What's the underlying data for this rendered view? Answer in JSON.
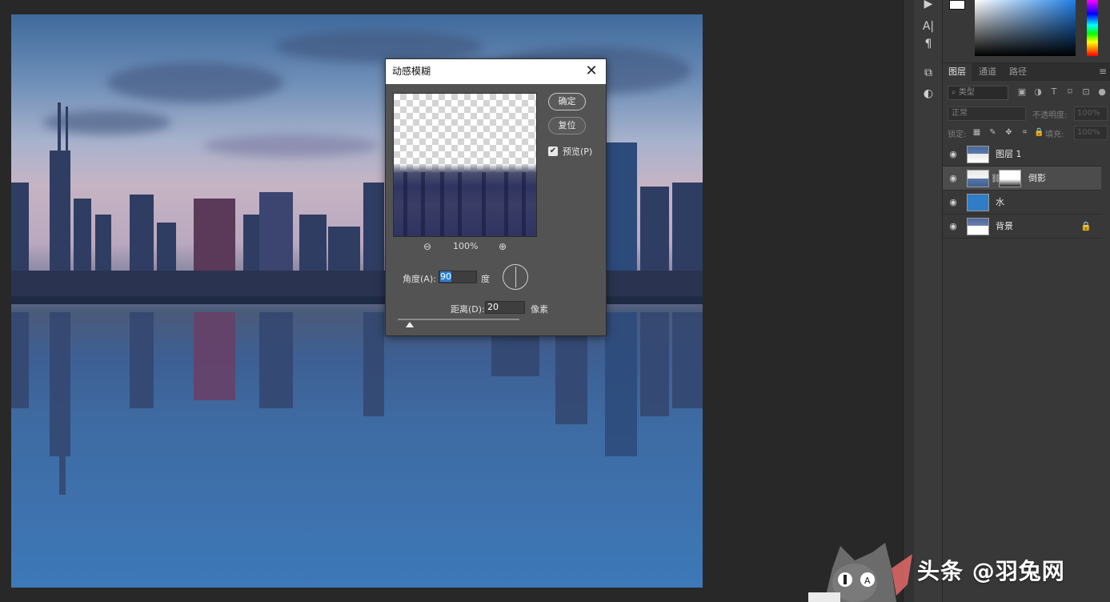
{
  "app": {
    "workspace_bg": "#282828",
    "panel_bg": "#383838",
    "accent": "#2a7fd4"
  },
  "canvas": {
    "description_colors": {
      "sky_top": "#3f6a9c",
      "water": "#3d78b8"
    }
  },
  "icon_strip": {
    "items": [
      {
        "icon": "play-icon",
        "glyph": "▶"
      },
      {
        "icon": "character-icon",
        "glyph": "A|"
      },
      {
        "icon": "paragraph-icon",
        "glyph": "¶"
      },
      {
        "icon": "libraries-icon",
        "glyph": "⧉"
      },
      {
        "icon": "adjustments-icon",
        "glyph": "◐"
      }
    ]
  },
  "layers_panel": {
    "tabs": [
      {
        "label": "图层",
        "active": true
      },
      {
        "label": "通道",
        "active": false
      },
      {
        "label": "路径",
        "active": false
      }
    ],
    "menu_glyph": "≡",
    "filter_placeholder": "类型",
    "filter_search_glyph": "⌕",
    "blend_mode": "正常",
    "opacity_label": "不透明度:",
    "opacity_value": "100%",
    "lock_label": "锁定:",
    "fill_label": "填充:",
    "fill_value": "100%",
    "layers": [
      {
        "name": "图层 1",
        "selected": false,
        "locked": false,
        "thumb": "checker-city"
      },
      {
        "name": "倒影",
        "selected": true,
        "locked": false,
        "thumb": "checker-mask"
      },
      {
        "name": "水",
        "selected": false,
        "locked": false,
        "thumb": "solid-blue"
      },
      {
        "name": "背景",
        "selected": false,
        "locked": true,
        "thumb": "city"
      }
    ]
  },
  "dialog": {
    "title": "动感模糊",
    "close_glyph": "✕",
    "ok_label": "确定",
    "reset_label": "复位",
    "preview_label": "预览(P)",
    "preview_checked": true,
    "zoom_out_glyph": "⊖",
    "zoom_in_glyph": "⊕",
    "zoom_level": "100%",
    "angle_label": "角度(A):",
    "angle_value": "90",
    "angle_unit": "度",
    "distance_label": "距离(D):",
    "distance_value": "20",
    "distance_unit": "像素",
    "distance_slider_fraction": 0.04
  },
  "watermark": {
    "text": "头条 @羽兔网"
  }
}
